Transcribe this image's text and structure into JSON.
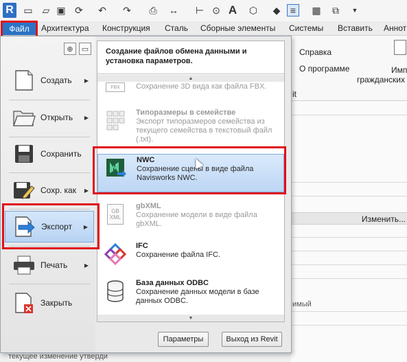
{
  "qat": {
    "logo": "R",
    "icons": [
      "file-icon",
      "open-icon",
      "save-icon",
      "sync-icon",
      "undo-icon",
      "redo-icon",
      "print-icon",
      "measure-icon",
      "dimension-icon",
      "pin-icon",
      "text-icon",
      "3d-view-icon",
      "tag-icon",
      "thin-lines-icon",
      "close-windows-icon",
      "switch-windows-icon",
      "dropdown-icon"
    ],
    "text_letter": "A"
  },
  "tabs": {
    "file": "Файл",
    "items": [
      "Архитектура",
      "Конструкция",
      "Сталь",
      "Сборные элементы",
      "Системы",
      "Вставить",
      "Аннот"
    ]
  },
  "ribbon": {
    "help": "Справка",
    "about": "О программе",
    "imp": "Имп",
    "civil": "гражданских",
    "it": "it"
  },
  "properties": {
    "edit": "Изменить...",
    "row1": "имый",
    "bottom": "текущее изменение утверди"
  },
  "menu": {
    "left_items": [
      {
        "label": "Создать",
        "icon": "new-file-icon",
        "arrow": true
      },
      {
        "label": "Открыть",
        "icon": "open-folder-icon",
        "arrow": true
      },
      {
        "label": "Сохранить",
        "icon": "save-icon",
        "arrow": false
      },
      {
        "label": "Сохр. как",
        "icon": "save-as-icon",
        "arrow": true
      },
      {
        "label": "Экспорт",
        "icon": "export-icon",
        "arrow": true
      },
      {
        "label": "Печать",
        "icon": "printer-icon",
        "arrow": true
      },
      {
        "label": "Закрыть",
        "icon": "close-file-icon",
        "arrow": false
      }
    ],
    "submenu": {
      "header": "Создание файлов обмена данными и установка параметров.",
      "items": [
        {
          "title": "",
          "desc": "Сохранение 3D вида как файла FBX.",
          "icon": "fbx-icon",
          "icon_text": "FBX",
          "dim": true
        },
        {
          "title": "Типоразмеры в семействе",
          "desc": "Экспорт типоразмеров семейства из текущего семейства в текстовый файл (.txt).",
          "icon": "family-types-icon",
          "dim": true
        },
        {
          "title": "NWC",
          "desc": "Сохранение сцены в виде файла Navisworks NWC.",
          "icon": "navisworks-icon",
          "dim": false
        },
        {
          "title": "gbXML",
          "desc": "Сохранение модели в виде файла gbXML.",
          "icon": "gbxml-icon",
          "icon_text": "GB XML",
          "dim": true
        },
        {
          "title": "IFC",
          "desc": "Сохранение файла IFC.",
          "icon": "ifc-icon",
          "dim": false
        },
        {
          "title": "База данных ODBC",
          "desc": "Сохранение данных модели в базе данных ODBC.",
          "icon": "database-icon",
          "dim": false
        }
      ]
    },
    "buttons": {
      "options": "Параметры",
      "exit": "Выход из Revit"
    }
  },
  "colors": {
    "accent": "#2a73c7",
    "highlight_box": "#e0101a",
    "active_item": "#b7d3f3"
  }
}
